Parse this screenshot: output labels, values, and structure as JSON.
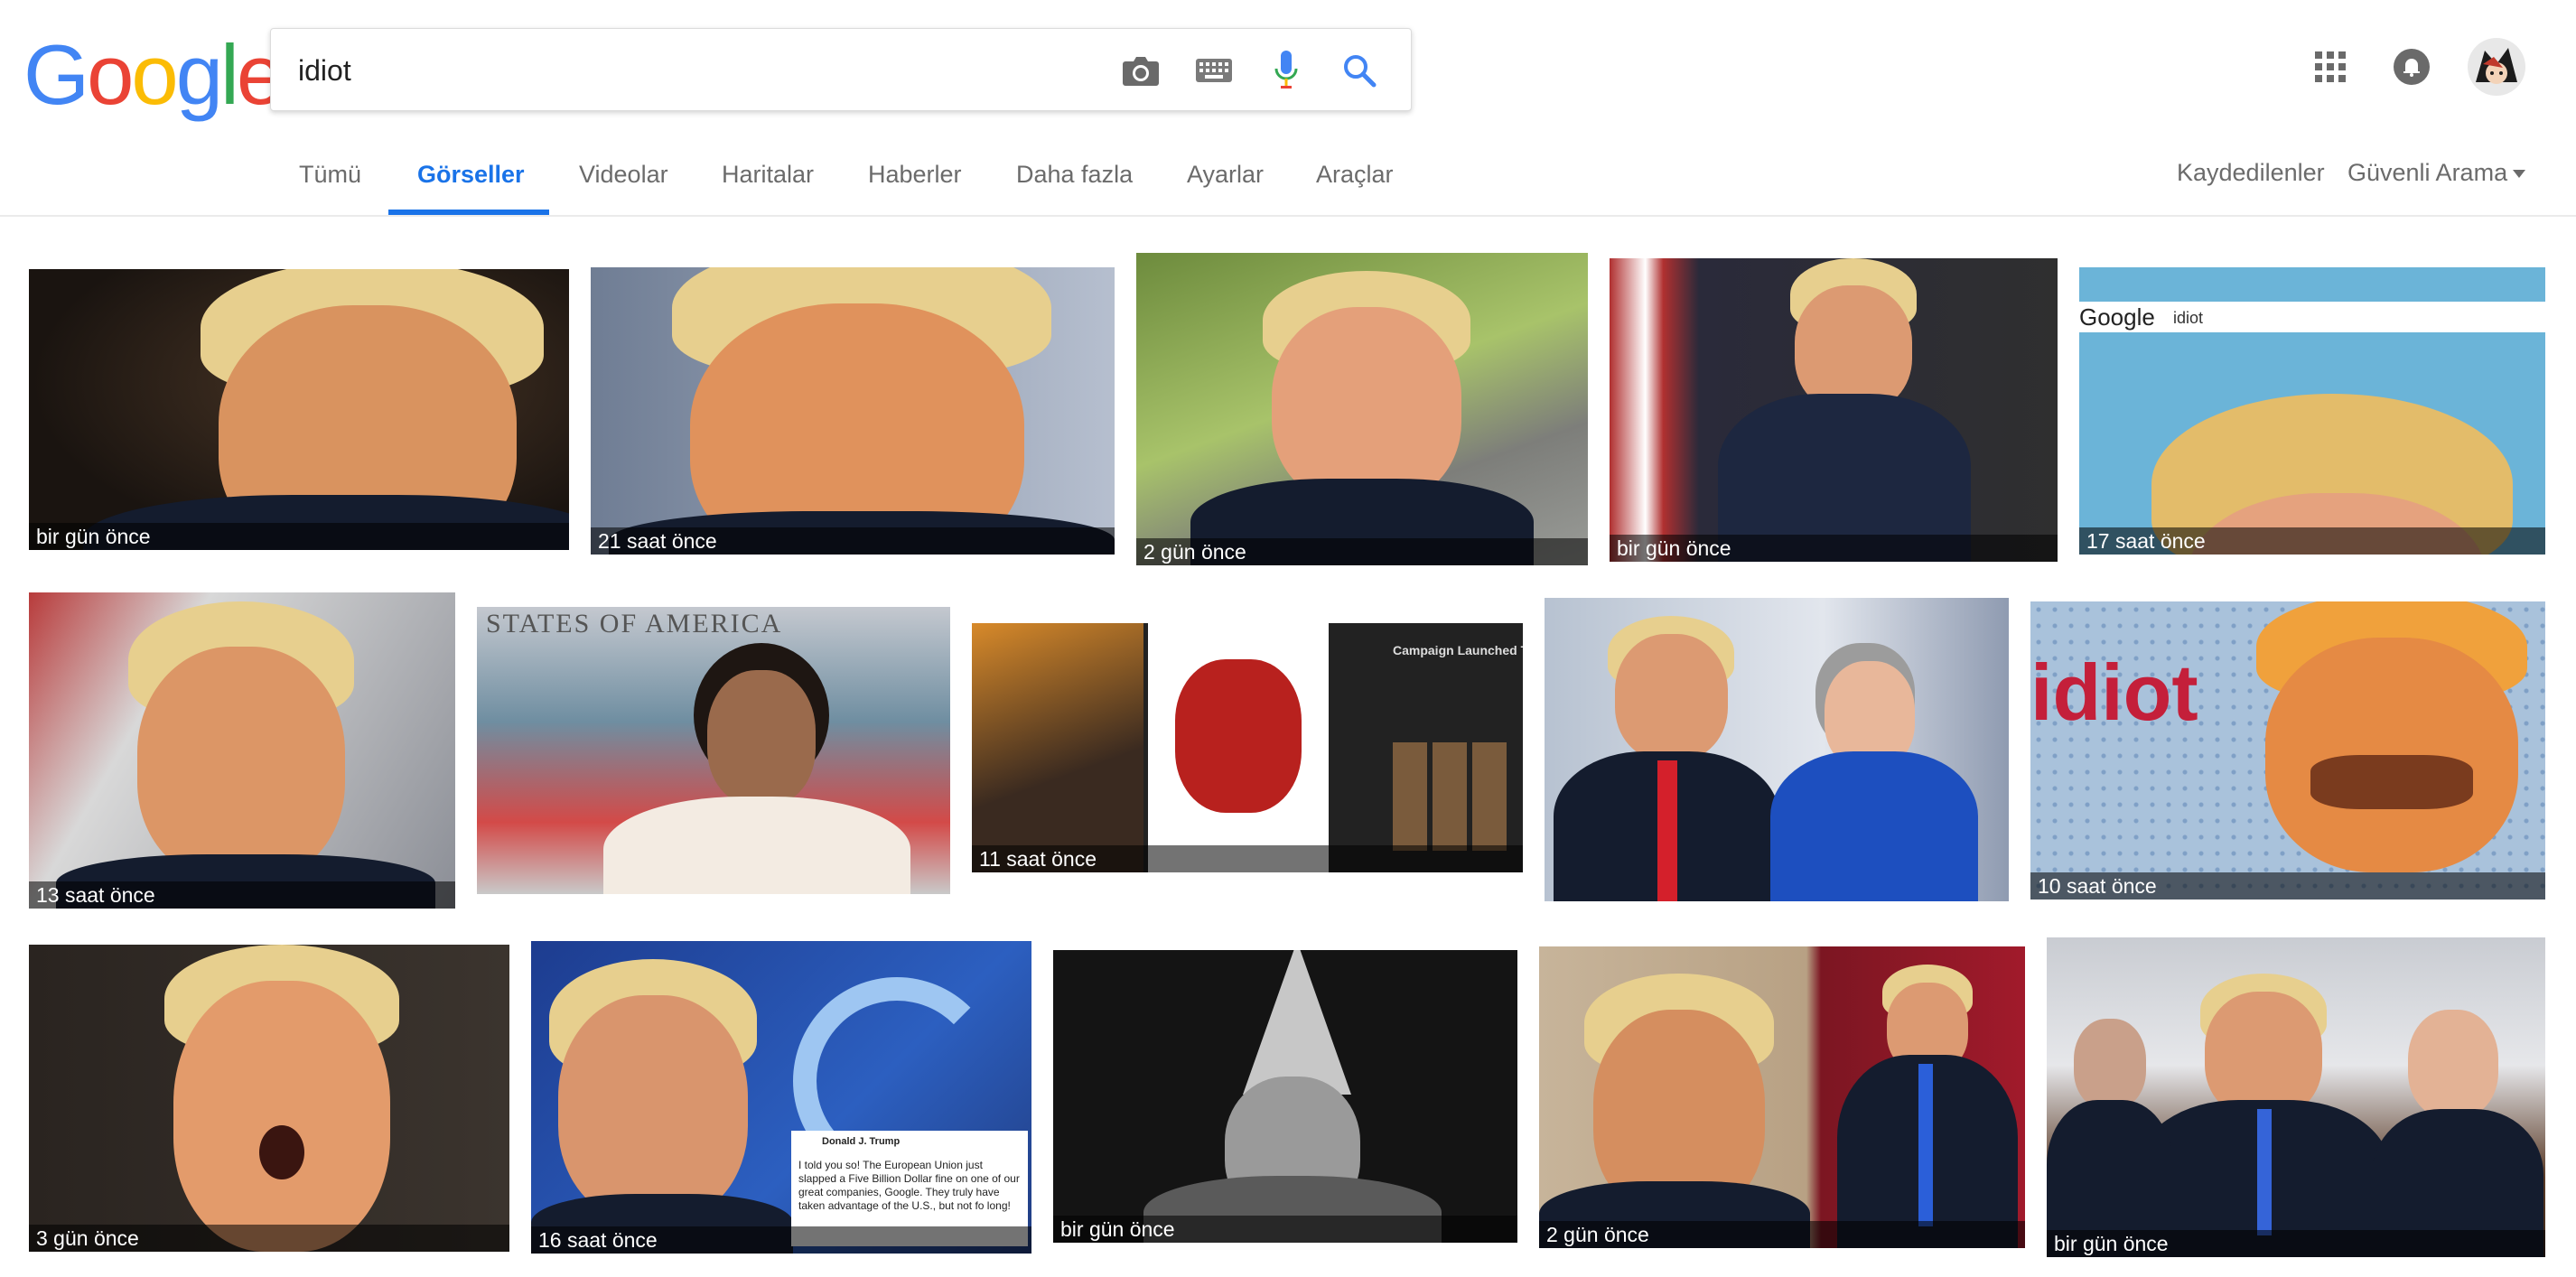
{
  "logo": {
    "text": "Google",
    "letters": [
      "G",
      "o",
      "o",
      "g",
      "l",
      "e"
    ],
    "colors": [
      "#4285F4",
      "#EA4335",
      "#FBBC05",
      "#4285F4",
      "#34A853",
      "#EA4335"
    ]
  },
  "search": {
    "query": "idiot",
    "placeholder": ""
  },
  "icons": {
    "camera": "camera-icon",
    "keyboard": "keyboard-icon",
    "mic": "microphone-icon",
    "search": "search-icon",
    "apps": "apps-grid-icon",
    "notifications": "notifications-bell-icon",
    "avatar": "account-avatar"
  },
  "tabs": [
    {
      "label": "Tümü",
      "active": false
    },
    {
      "label": "Görseller",
      "active": true
    },
    {
      "label": "Videolar",
      "active": false
    },
    {
      "label": "Haritalar",
      "active": false
    },
    {
      "label": "Haberler",
      "active": false
    },
    {
      "label": "Daha fazla",
      "active": false
    },
    {
      "label": "Ayarlar",
      "active": false
    },
    {
      "label": "Araçlar",
      "active": false
    }
  ],
  "right_links": {
    "saved": "Kaydedilenler",
    "safe_search": "Güvenli Arama"
  },
  "accent_color": "#1a73e8",
  "results": [
    {
      "age": "bir gün önce"
    },
    {
      "age": "21 saat önce"
    },
    {
      "age": "2 gün önce"
    },
    {
      "age": "bir gün önce"
    },
    {
      "age": "17 saat önce",
      "overlay": {
        "logo": "Google",
        "query": "idiot"
      }
    },
    {
      "age": "13 saat önce"
    },
    {
      "age": "",
      "overlay": {
        "text": "STATES OF AMERICA"
      }
    },
    {
      "age": "11 saat önce",
      "overlay": {
        "headline": "Campaign Launched To G"
      }
    },
    {
      "age": ""
    },
    {
      "age": "10 saat önce",
      "overlay": {
        "text": "idiot"
      }
    },
    {
      "age": "3 gün önce"
    },
    {
      "age": "16 saat önce",
      "overlay": {
        "author": "Donald J. Trump",
        "tweet": "I told you so! The European Union just slapped a Five Billion Dollar fine on one of our great companies, Google. They truly have taken advantage of the U.S., but not fo long!"
      }
    },
    {
      "age": "bir gün önce"
    },
    {
      "age": "2 gün önce"
    },
    {
      "age": "bir gün önce"
    }
  ]
}
